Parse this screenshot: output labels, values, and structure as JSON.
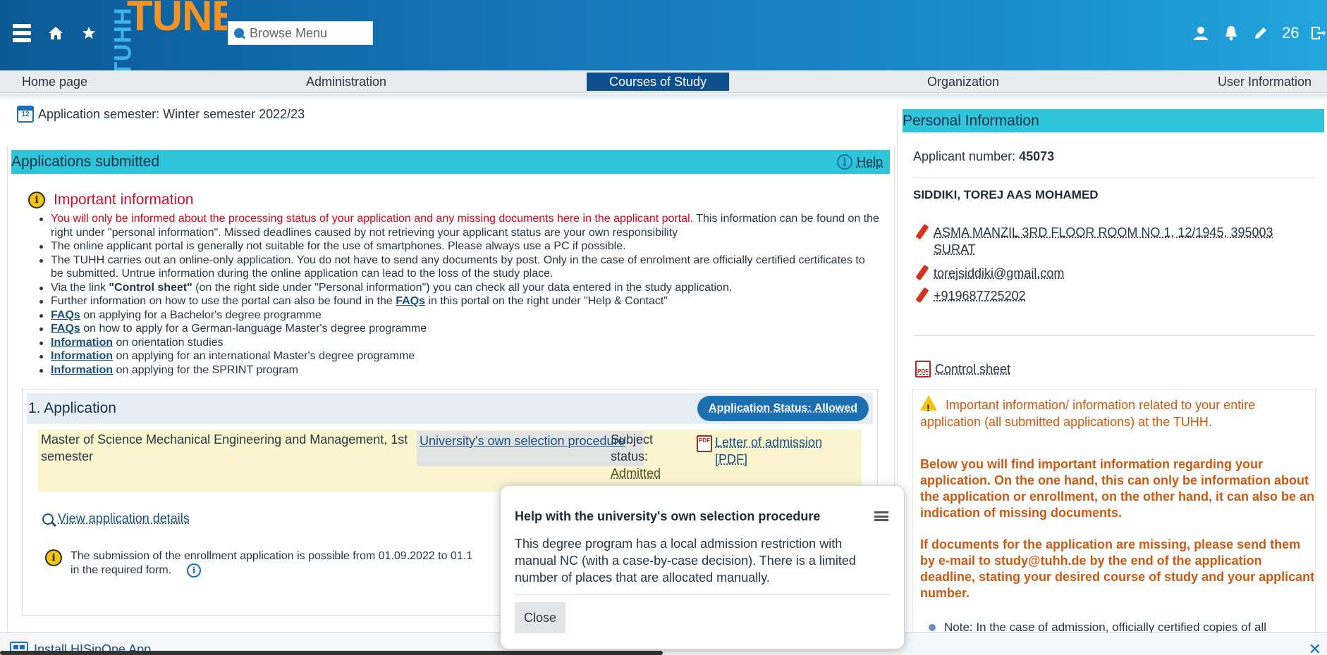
{
  "header": {
    "logo_side": "TUHH",
    "logo_main": "TUNE",
    "search_placeholder": "Browse Menu",
    "counter": "26"
  },
  "nav": {
    "items": [
      "Home page",
      "Administration",
      "Courses of Study",
      "Organization",
      "User Information"
    ],
    "active": "Courses of Study"
  },
  "main": {
    "semester_icon_text": "12",
    "semester": "Application semester: Winter semester 2022/23",
    "section_title": "Applications submitted",
    "help": "Help",
    "important_title": "Important information",
    "bullets": {
      "b1_red": "You will only be informed about the processing status of your application and any missing documents here in the applicant portal.",
      "b1_rest": " This information can be found on the right under \"personal information\". Missed deadlines caused by not retrieving your applicant status are your own responsibility",
      "b2": "The online applicant portal is generally not suitable for the use of smartphones. Please always use a PC if possible.",
      "b3": "The TUHH carries out an online-only application. You do not have to send any documents by post. Only in the case of enrolment are officially certified certificates to be submitted. Untrue information during the online application can lead to the loss of the study place.",
      "b4_pre": "Via the link ",
      "b4_bold": "\"Control sheet\"",
      "b4_post": " (on the right side under \"Personal information\") you can check all your data entered in the study application.",
      "b5_pre": "Further information on how to use the portal can also be found in the ",
      "b5_link": "FAQs",
      "b5_post": " in this portal on the right under \"Help & Contact\"",
      "b6_link": "FAQs",
      "b6_text": " on applying for a Bachelor's degree programme",
      "b7_link": "FAQs",
      "b7_text": " on how to apply for a German-language Master's degree programme",
      "b8_link": "Information",
      "b8_text": " on orientation studies",
      "b9_link": "Information",
      "b9_text": " on applying for an international Master's degree programme",
      "b10_link": "Information",
      "b10_text": " on applying for the SPRINT program"
    },
    "application": {
      "title": "1. Application",
      "status": "Application Status: Allowed",
      "program": "Master of Science Mechanical Engineering and Management, 1st semester",
      "procedure": "University's own selection procedure",
      "subject_status_label": "Subject status:",
      "subject_status_value": "Admitted",
      "pdf_icon_text": "PDF",
      "letter_link": "Letter of admission [PDF]",
      "view_details": "View application details",
      "enroll_note": "The submission of the enrollment application is possible from 01.09.2022 to 01.1",
      "enroll_note_2": "in the required form."
    }
  },
  "personal": {
    "title": "Personal Information",
    "applicant_label": "Applicant number: ",
    "applicant_number": "45073",
    "name": "SIDDIKI, TOREJ AAS MOHAMED",
    "address": "ASMA MANZIL 3RD FLOOR ROOM NO 1, 12/1945, 395003 SURAT",
    "email": "torejsiddiki@gmail.com",
    "phone": "+919687725202",
    "control_sheet": "Control sheet",
    "warn_title": "Important information/ information related to your entire application (all submitted applications) at the TUHH.",
    "warn_p1": "Below you will find important information regarding your application. On the one hand, this can only be information about the application or enrollment, on the other hand, it can also be an indication of missing documents.",
    "warn_p2": "If documents for the application are missing, please send them by e-mail to study@tuhh.de by the end of the application deadline, stating your desired course of study and your applicant number.",
    "note_item": "Note: In the case of admission, officially certified copies of all"
  },
  "install": {
    "label": "Install HISinOne App"
  },
  "popup": {
    "title": "Help with the university's own selection procedure",
    "body": "This degree program has a local admission restriction with manual NC (with a case-by-case decision). There is a limited number of places that are allocated manually.",
    "close": "Close"
  },
  "colors": {
    "header_start": "#0b5a96",
    "header_end": "#22a5de",
    "section_bar": "#2ec4d9",
    "nav_active": "#0d4f8f",
    "important_red": "#c8102e",
    "warning_orange": "#c85a14",
    "application_row": "#faf4cf"
  },
  "icons": [
    "menu-icon",
    "home-icon",
    "star-icon",
    "search-icon",
    "user-icon",
    "bell-icon",
    "pencil-icon",
    "logout-icon",
    "calendar-icon",
    "info-icon",
    "pdf-icon",
    "magnifier-icon",
    "warning-icon"
  ]
}
